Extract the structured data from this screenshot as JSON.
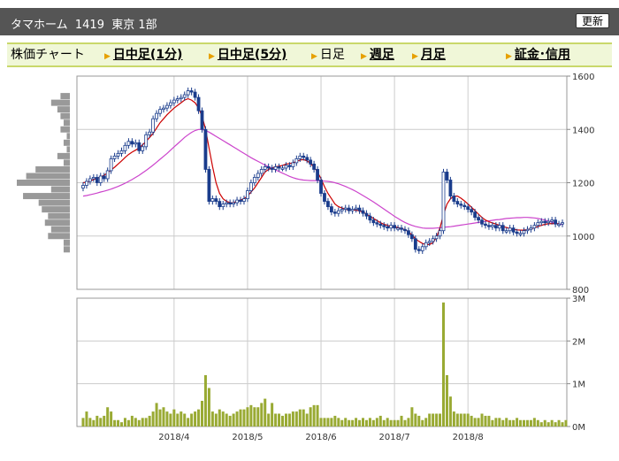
{
  "header": {
    "title": "タマホーム  1419  東京 1部",
    "refresh_label": "更新"
  },
  "nav": {
    "items": [
      {
        "label": "株価チャート",
        "link": false,
        "marker": false
      },
      {
        "label": "日中足(1分)",
        "link": true,
        "marker": true
      },
      {
        "label": "日中足(5分)",
        "link": true,
        "marker": true
      },
      {
        "label": "日足",
        "link": false,
        "marker": true
      },
      {
        "label": "週足",
        "link": true,
        "marker": true
      },
      {
        "label": "月足",
        "link": true,
        "marker": true
      },
      {
        "label": "証金･信用",
        "link": true,
        "marker": true
      }
    ]
  },
  "colors": {
    "candle": "#1a3c8c",
    "ma_short": "#cc0000",
    "ma_long": "#cc44cc",
    "volume": "#99aa33",
    "profile": "#999999",
    "grid": "#cccccc"
  },
  "chart_data": [
    {
      "type": "candlestick",
      "title": "",
      "ylim": [
        800,
        1600
      ],
      "y_ticks": [
        "1600",
        "1400",
        "1200",
        "1000",
        "800"
      ],
      "x_ticks": [
        "2018/4",
        "2018/5",
        "2018/6",
        "2018/7",
        "2018/8"
      ],
      "x_tick_index": [
        26,
        47,
        68,
        89,
        110
      ],
      "grid": true,
      "series": [
        {
          "kind": "close",
          "values": [
            1190,
            1205,
            1215,
            1220,
            1200,
            1225,
            1215,
            1245,
            1290,
            1300,
            1310,
            1320,
            1340,
            1355,
            1345,
            1350,
            1320,
            1335,
            1380,
            1390,
            1440,
            1460,
            1475,
            1480,
            1490,
            1500,
            1510,
            1515,
            1520,
            1530,
            1545,
            1540,
            1520,
            1470,
            1400,
            1250,
            1130,
            1140,
            1130,
            1110,
            1120,
            1125,
            1120,
            1125,
            1135,
            1130,
            1140,
            1170,
            1200,
            1220,
            1235,
            1250,
            1260,
            1255,
            1250,
            1260,
            1255,
            1255,
            1265,
            1260,
            1275,
            1290,
            1300,
            1295,
            1285,
            1270,
            1250,
            1210,
            1160,
            1130,
            1110,
            1090,
            1085,
            1095,
            1100,
            1105,
            1095,
            1100,
            1105,
            1095,
            1085,
            1075,
            1060,
            1050,
            1045,
            1040,
            1035,
            1030,
            1040,
            1030,
            1030,
            1025,
            1020,
            1005,
            990,
            950,
            945,
            960,
            975,
            980,
            990,
            1000,
            1020,
            1240,
            1210,
            1150,
            1130,
            1120,
            1115,
            1110,
            1100,
            1090,
            1070,
            1060,
            1045,
            1040,
            1035,
            1040,
            1030,
            1040,
            1020,
            1020,
            1030,
            1015,
            1010,
            1010,
            1020,
            1025,
            1030,
            1040,
            1050,
            1055,
            1050,
            1055,
            1060,
            1045,
            1045,
            1050
          ]
        },
        {
          "kind": "ma_short",
          "values": [
            1200,
            1202,
            1206,
            1212,
            1216,
            1222,
            1228,
            1237,
            1248,
            1258,
            1270,
            1282,
            1295,
            1306,
            1315,
            1322,
            1330,
            1342,
            1355,
            1370,
            1385,
            1405,
            1425,
            1440,
            1455,
            1468,
            1480,
            1490,
            1500,
            1510,
            1515,
            1510,
            1500,
            1480,
            1450,
            1400,
            1330,
            1260,
            1200,
            1160,
            1140,
            1130,
            1125,
            1125,
            1130,
            1135,
            1140,
            1150,
            1165,
            1180,
            1200,
            1220,
            1240,
            1250,
            1255,
            1260,
            1262,
            1265,
            1270,
            1272,
            1275,
            1280,
            1285,
            1287,
            1282,
            1272,
            1258,
            1240,
            1215,
            1185,
            1160,
            1140,
            1120,
            1110,
            1105,
            1100,
            1098,
            1098,
            1097,
            1094,
            1090,
            1082,
            1074,
            1066,
            1058,
            1050,
            1044,
            1040,
            1036,
            1034,
            1032,
            1028,
            1024,
            1016,
            1004,
            990,
            980,
            972,
            968,
            968,
            975,
            995,
            1030,
            1080,
            1120,
            1140,
            1150,
            1150,
            1142,
            1132,
            1120,
            1108,
            1095,
            1082,
            1070,
            1060,
            1054,
            1049,
            1045,
            1040,
            1035,
            1032,
            1028,
            1025,
            1023,
            1022,
            1022,
            1024,
            1027,
            1031,
            1036,
            1040,
            1044,
            1046,
            1047,
            1046,
            1046
          ]
        },
        {
          "kind": "ma_long",
          "values": [
            1150,
            1152,
            1155,
            1158,
            1161,
            1165,
            1168,
            1172,
            1176,
            1181,
            1186,
            1192,
            1198,
            1205,
            1212,
            1220,
            1228,
            1237,
            1246,
            1256,
            1266,
            1277,
            1288,
            1299,
            1310,
            1322,
            1334,
            1346,
            1358,
            1370,
            1380,
            1389,
            1396,
            1400,
            1400,
            1396,
            1390,
            1382,
            1374,
            1366,
            1358,
            1350,
            1342,
            1334,
            1326,
            1318,
            1310,
            1302,
            1294,
            1287,
            1280,
            1273,
            1266,
            1260,
            1254,
            1248,
            1242,
            1236,
            1230,
            1224,
            1219,
            1215,
            1212,
            1210,
            1209,
            1208,
            1208,
            1208,
            1207,
            1206,
            1205,
            1203,
            1200,
            1196,
            1191,
            1186,
            1180,
            1174,
            1167,
            1160,
            1152,
            1144,
            1136,
            1128,
            1119,
            1110,
            1101,
            1092,
            1083,
            1074,
            1066,
            1058,
            1051,
            1045,
            1040,
            1036,
            1033,
            1030,
            1029,
            1029,
            1029,
            1030,
            1031,
            1033,
            1034,
            1035,
            1037,
            1039,
            1041,
            1043,
            1045,
            1047,
            1049,
            1051,
            1053,
            1055,
            1057,
            1059,
            1061,
            1062,
            1064,
            1066,
            1067,
            1068,
            1069,
            1069,
            1070,
            1070,
            1069,
            1068,
            1066,
            1063,
            1060,
            1056,
            1052,
            1048,
            1045,
            1043
          ]
        }
      ]
    },
    {
      "type": "bar",
      "title": "",
      "ylim": [
        0,
        3
      ],
      "y_ticks": [
        "3M",
        "2M",
        "1M",
        "0M"
      ],
      "series": [
        {
          "name": "",
          "values": [
            0.2,
            0.35,
            0.2,
            0.15,
            0.25,
            0.2,
            0.25,
            0.45,
            0.35,
            0.15,
            0.15,
            0.1,
            0.2,
            0.15,
            0.25,
            0.2,
            0.15,
            0.2,
            0.2,
            0.25,
            0.35,
            0.55,
            0.4,
            0.45,
            0.35,
            0.3,
            0.4,
            0.3,
            0.35,
            0.3,
            0.2,
            0.3,
            0.35,
            0.4,
            0.6,
            1.2,
            0.9,
            0.35,
            0.3,
            0.4,
            0.35,
            0.3,
            0.25,
            0.3,
            0.35,
            0.4,
            0.4,
            0.45,
            0.5,
            0.45,
            0.45,
            0.55,
            0.65,
            0.3,
            0.55,
            0.3,
            0.3,
            0.25,
            0.3,
            0.3,
            0.35,
            0.35,
            0.4,
            0.4,
            0.3,
            0.45,
            0.5,
            0.5,
            0.2,
            0.2,
            0.2,
            0.2,
            0.25,
            0.2,
            0.15,
            0.2,
            0.15,
            0.15,
            0.2,
            0.15,
            0.2,
            0.15,
            0.2,
            0.15,
            0.2,
            0.25,
            0.15,
            0.2,
            0.15,
            0.15,
            0.15,
            0.25,
            0.15,
            0.2,
            0.45,
            0.3,
            0.25,
            0.15,
            0.2,
            0.3,
            0.3,
            0.3,
            0.3,
            2.9,
            1.2,
            0.7,
            0.35,
            0.3,
            0.3,
            0.3,
            0.3,
            0.25,
            0.2,
            0.2,
            0.3,
            0.25,
            0.25,
            0.15,
            0.2,
            0.2,
            0.15,
            0.2,
            0.15,
            0.15,
            0.2,
            0.15,
            0.15,
            0.15,
            0.15,
            0.2,
            0.15,
            0.1,
            0.15,
            0.1,
            0.15,
            0.1,
            0.15,
            0.1,
            0.15
          ]
        }
      ]
    },
    {
      "type": "bar",
      "title": "",
      "orientation": "horizontal",
      "categories": [
        1525,
        1500,
        1475,
        1450,
        1425,
        1400,
        1375,
        1350,
        1325,
        1300,
        1275,
        1250,
        1225,
        1200,
        1175,
        1150,
        1125,
        1100,
        1075,
        1050,
        1025,
        1000,
        975,
        950
      ],
      "values": [
        0.15,
        0.3,
        0.2,
        0.15,
        0.1,
        0.15,
        0.05,
        0.1,
        0.05,
        0.2,
        0.1,
        0.55,
        0.7,
        0.85,
        0.3,
        0.75,
        0.5,
        0.45,
        0.35,
        0.4,
        0.3,
        0.35,
        0.1,
        0.1
      ]
    }
  ]
}
